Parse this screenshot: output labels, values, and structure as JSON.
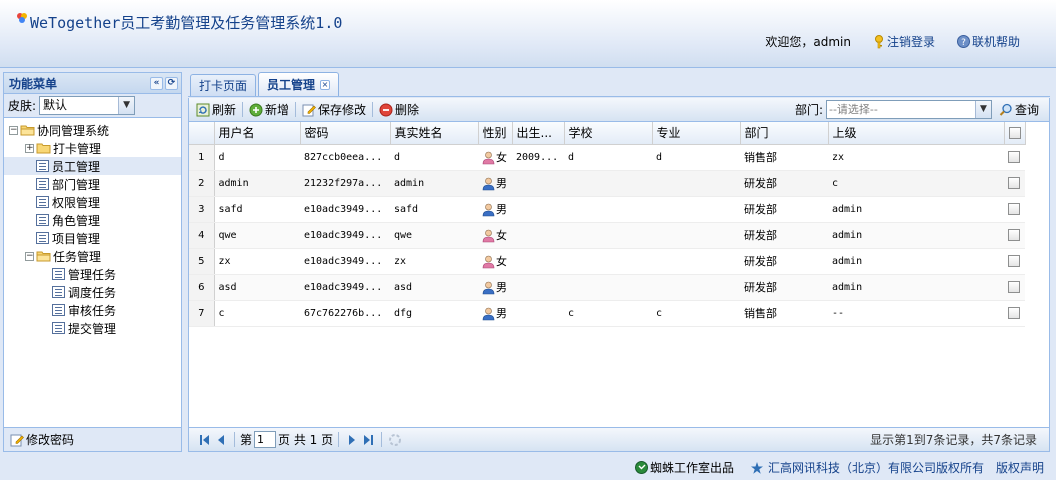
{
  "header": {
    "title": "WeTogether员工考勤管理及任务管理系统1.0",
    "welcome": "欢迎您，admin",
    "logout": "注销登录",
    "help": "联机帮助"
  },
  "left_panel": {
    "title": "功能菜单",
    "skin_label": "皮肤:",
    "skin_value": "默认",
    "tree": {
      "root": "协同管理系统",
      "punch": "打卡管理",
      "employee": "员工管理",
      "department": "部门管理",
      "permission": "权限管理",
      "role": "角色管理",
      "project": "项目管理",
      "task": "任务管理",
      "task_manage": "管理任务",
      "task_schedule": "调度任务",
      "task_review": "审核任务",
      "task_submit": "提交管理"
    },
    "footer": "修改密码"
  },
  "tabs": [
    {
      "label": "打卡页面"
    },
    {
      "label": "员工管理"
    }
  ],
  "toolbar": {
    "refresh": "刷新",
    "add": "新增",
    "save": "保存修改",
    "delete": "删除",
    "dept_label": "部门:",
    "dept_placeholder": "--请选择--",
    "search": "查询"
  },
  "grid": {
    "columns": [
      "用户名",
      "密码",
      "真实姓名",
      "性别",
      "出生...",
      "学校",
      "专业",
      "部门",
      "上级"
    ],
    "rows": [
      {
        "num": "1",
        "username": "d",
        "password": "827ccb0eea...",
        "realname": "d",
        "gender": "女",
        "birth": "2009...",
        "school": "d",
        "major": "d",
        "dept": "销售部",
        "superior": "zx"
      },
      {
        "num": "2",
        "username": "admin",
        "password": "21232f297a...",
        "realname": "admin",
        "gender": "男",
        "birth": "",
        "school": "",
        "major": "",
        "dept": "研发部",
        "superior": "c"
      },
      {
        "num": "3",
        "username": "safd",
        "password": "e10adc3949...",
        "realname": "safd",
        "gender": "男",
        "birth": "",
        "school": "",
        "major": "",
        "dept": "研发部",
        "superior": "admin"
      },
      {
        "num": "4",
        "username": "qwe",
        "password": "e10adc3949...",
        "realname": "qwe",
        "gender": "女",
        "birth": "",
        "school": "",
        "major": "",
        "dept": "研发部",
        "superior": "admin"
      },
      {
        "num": "5",
        "username": "zx",
        "password": "e10adc3949...",
        "realname": "zx",
        "gender": "女",
        "birth": "",
        "school": "",
        "major": "",
        "dept": "研发部",
        "superior": "admin"
      },
      {
        "num": "6",
        "username": "asd",
        "password": "e10adc3949...",
        "realname": "asd",
        "gender": "男",
        "birth": "",
        "school": "",
        "major": "",
        "dept": "研发部",
        "superior": "admin"
      },
      {
        "num": "7",
        "username": "c",
        "password": "67c762276b...",
        "realname": "dfg",
        "gender": "男",
        "birth": "",
        "school": "c",
        "major": "c",
        "dept": "销售部",
        "superior": "--"
      }
    ]
  },
  "paging": {
    "page_prefix": "第",
    "page_value": "1",
    "page_suffix": "页 共 1 页",
    "info": "显示第1到7条记录，共7条记录"
  },
  "footer": {
    "studio": "蜘蛛工作室出品",
    "company": "汇高网讯科技（北京）有限公司版权所有",
    "copyright": "版权声明"
  },
  "colors": {
    "accent": "#15428b",
    "border": "#99bbe8",
    "background": "#dfe8f6"
  }
}
